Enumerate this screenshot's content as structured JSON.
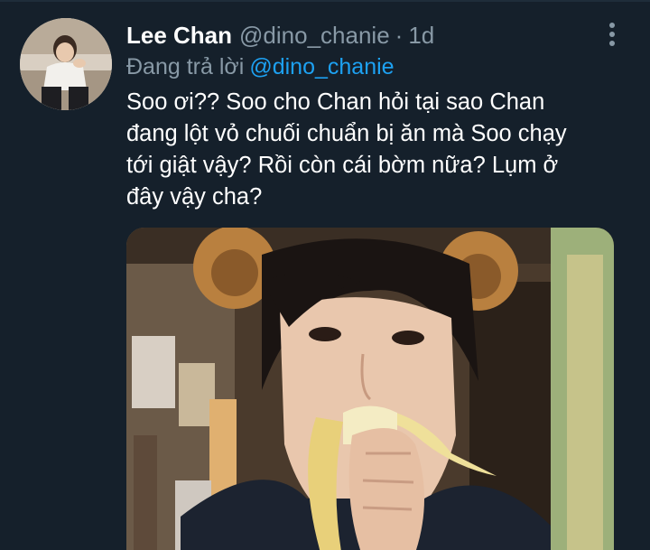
{
  "tweet": {
    "display_name": "Lee Chan",
    "handle": "@dino_chanie",
    "separator": "·",
    "timestamp": "1d",
    "reply_prefix": "Đang trả lời",
    "reply_to": "@dino_chanie",
    "text": "Soo ơi?? Soo cho Chan hỏi tại sao Chan\nđang lột vỏ chuối chuẩn bị ăn mà Soo chạy\ntới giật vậy? Rồi còn cái bờm nữa? Lụm ở\nđây vậy cha?"
  },
  "icons": {
    "more": "more-vertical-icon",
    "avatar": "avatar-photo",
    "media": "attached-photo"
  },
  "colors": {
    "background": "#15202b",
    "primary_text": "#ffffff",
    "secondary_text": "#8899a6",
    "link": "#1da1f2"
  }
}
